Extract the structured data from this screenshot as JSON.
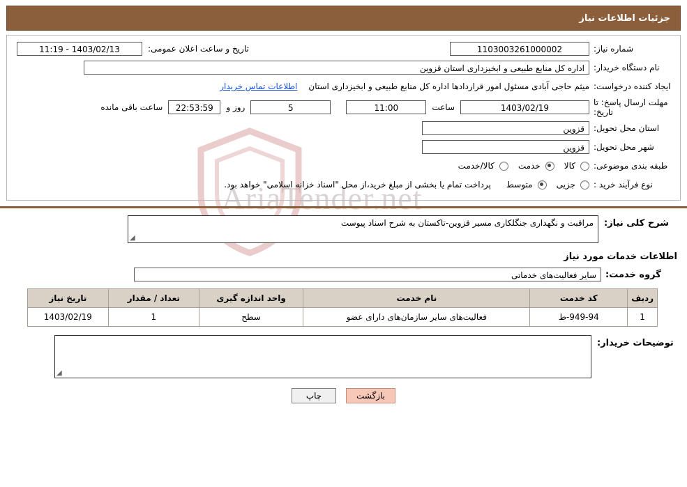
{
  "header": {
    "title": "جزئیات اطلاعات نیاز"
  },
  "form": {
    "need_number_label": "شماره نیاز:",
    "need_number_value": "1103003261000002",
    "announce_datetime_label": "تاریخ و ساعت اعلان عمومی:",
    "announce_datetime_value": "1403/02/13 - 11:19",
    "buyer_org_label": "نام دستگاه خریدار:",
    "buyer_org_value": "اداره کل منابع طبیعی و ابخیزداری استان قزوین",
    "requester_label": "ایجاد کننده درخواست:",
    "requester_value": "میثم حاجی آبادی مسئول امور قراردادها اداره کل منابع طبیعی و ابخیزداری استان",
    "contact_link": "اطلاعات تماس خریدار",
    "deadline_label": "مهلت ارسال پاسخ: تا تاریخ:",
    "deadline_date": "1403/02/19",
    "hour_label": "ساعت",
    "deadline_time": "11:00",
    "days_value": "5",
    "days_label": "روز و",
    "countdown_value": "22:53:59",
    "remaining_label": "ساعت باقی مانده",
    "province_label": "استان محل تحویل:",
    "province_value": "قزوین",
    "city_label": "شهر محل تحویل:",
    "city_value": "قزوین",
    "category_label": "طبقه بندی موضوعی:",
    "category_options": [
      {
        "label": "کالا",
        "checked": false
      },
      {
        "label": "خدمت",
        "checked": true
      },
      {
        "label": "کالا/خدمت",
        "checked": false
      }
    ],
    "process_label": "نوع فرآیند خرید :",
    "process_options": [
      {
        "label": "جزیی",
        "checked": false
      },
      {
        "label": "متوسط",
        "checked": true
      }
    ],
    "process_note": "پرداخت تمام یا بخشی از مبلغ خرید،از محل \"اسناد خزانه اسلامی\" خواهد بود."
  },
  "description": {
    "label": "شرح کلی نیاز:",
    "value": "مراقبت و نگهداری جنگلکاری مسیر قزوین-تاکستان به شرح اسناد پیوست"
  },
  "services": {
    "heading": "اطلاعات خدمات مورد نیاز",
    "group_label": "گروه خدمت:",
    "group_value": "سایر فعالیت‌های خدماتی",
    "table": {
      "columns": [
        "ردیف",
        "کد خدمت",
        "نام خدمت",
        "واحد اندازه گیری",
        "تعداد / مقدار",
        "تاریخ نیاز"
      ],
      "rows": [
        {
          "index": "1",
          "code": "949-94-ط",
          "name": "فعالیت‌های سایر سازمان‌های دارای عضو",
          "unit": "سطح",
          "quantity": "1",
          "date": "1403/02/19"
        }
      ]
    }
  },
  "buyer_notes": {
    "label": "توضیحات خریدار:",
    "value": ""
  },
  "footer": {
    "print_label": "چاپ",
    "back_label": "بازگشت"
  },
  "watermark": {
    "text": "AriaTender.net"
  }
}
